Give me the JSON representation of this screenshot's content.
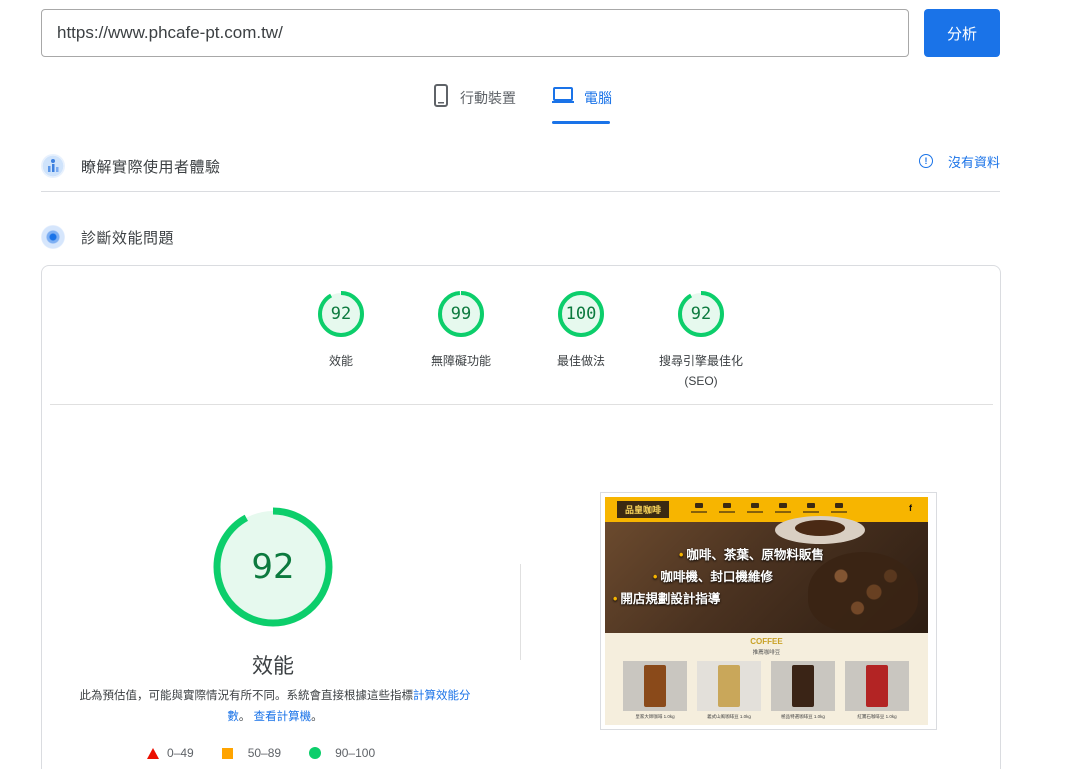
{
  "search": {
    "url_value": "https://www.phcafe-pt.com.tw/",
    "analyze_label": "分析"
  },
  "tabs": [
    {
      "label": "行動裝置",
      "icon": "smartphone-icon",
      "selected": false
    },
    {
      "label": "電腦",
      "icon": "laptop-icon",
      "selected": true
    }
  ],
  "crux": {
    "title": "瞭解實際使用者體驗",
    "no_data_label": "沒有資料",
    "icon": "users-icon"
  },
  "lab": {
    "title": "診斷效能問題",
    "icon": "lab-icon"
  },
  "scores": [
    {
      "value": "92",
      "label": "效能",
      "label2": ""
    },
    {
      "value": "99",
      "label": "無障礙功能",
      "label2": ""
    },
    {
      "value": "100",
      "label": "最佳做法",
      "label2": ""
    },
    {
      "value": "92",
      "label": "搜尋引擎最佳化",
      "label2": "(SEO)"
    }
  ],
  "main_score": {
    "value": "92",
    "title": "效能",
    "desc_text": "此為預估值，可能與實際情況有所不同。系統會直接根據這些指標",
    "desc_link1": "計算效能分數",
    "desc_sep": "。",
    "desc_link2": "查看計算機",
    "desc_end": "。"
  },
  "legend": [
    {
      "range": "0–49",
      "shape": "triangle",
      "color": "#eb0f00"
    },
    {
      "range": "50–89",
      "shape": "square",
      "color": "#ffa400"
    },
    {
      "range": "90–100",
      "shape": "circle",
      "color": "#0cce6b"
    }
  ],
  "site_preview": {
    "logo_text": "品皇咖啡",
    "hero_lines": [
      "咖啡、茶葉、原物料販售",
      "咖啡機、封口機維修",
      "開店規劃設計指導"
    ],
    "section_title": "COFFEE",
    "section_sub": "推薦咖啡豆",
    "products": [
      "皇家大師咖啡 1.0kg",
      "義式山風咖啡豆 1.0kg",
      "極品特選咖啡豆 1.0kg",
      "紅寶石咖啡豆 1.0kg"
    ],
    "facebook_icon": "f"
  },
  "colors": {
    "accent": "#1a73e8",
    "pass": "#0cce6b",
    "pass_text": "#0c7a3e"
  }
}
